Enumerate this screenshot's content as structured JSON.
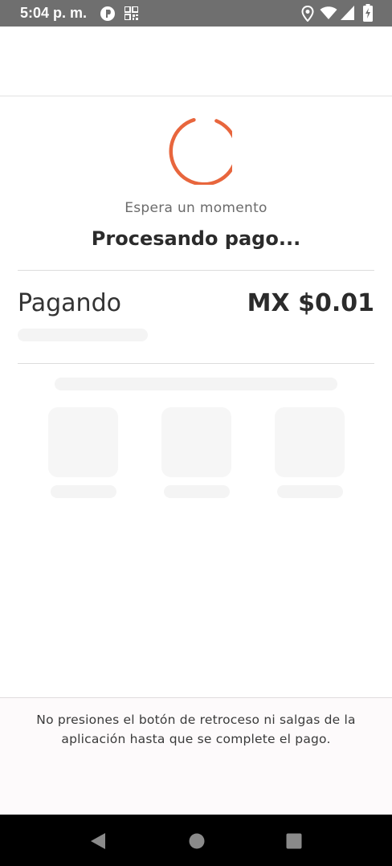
{
  "status_bar": {
    "time": "5:04 p. m.",
    "left_icons": [
      "play-protect-icon",
      "qr-code-icon"
    ],
    "right_icons": [
      "location-icon",
      "wifi-icon",
      "signal-icon",
      "battery-charging-icon"
    ]
  },
  "loading": {
    "indicator": "spinner",
    "accent_color": "#e8663d",
    "subtitle": "Espera un momento",
    "title": "Procesando pago..."
  },
  "payment": {
    "label": "Pagando",
    "amount": "MX $0.01"
  },
  "footer": {
    "notice": "No presiones el botón de retroceso ni salgas de la aplicación hasta que se complete el pago."
  },
  "nav_bar": {
    "buttons": [
      "back-icon",
      "home-icon",
      "recents-icon"
    ]
  }
}
